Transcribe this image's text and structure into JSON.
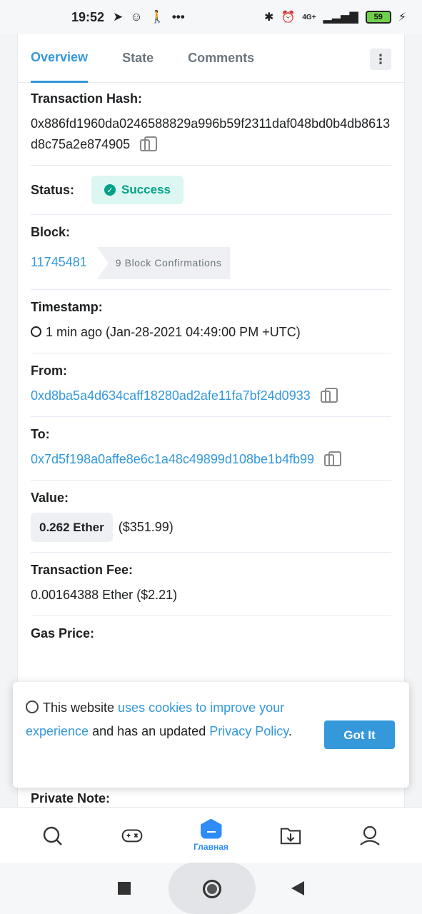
{
  "status_bar": {
    "time": "19:52",
    "left_icons": [
      "telegram-icon",
      "alien-icon",
      "walking-icon",
      "more-dots-icon"
    ],
    "network": "4G+",
    "battery": "59"
  },
  "tabs": [
    {
      "label": "Overview",
      "active": true
    },
    {
      "label": "State",
      "active": false
    },
    {
      "label": "Comments",
      "active": false
    }
  ],
  "tx": {
    "hash_label": "Transaction Hash:",
    "hash": "0x886fd1960da0246588829a996b59f2311daf048bd0b4db8613d8c75a2e874905",
    "status_label": "Status:",
    "status": "Success",
    "block_label": "Block:",
    "block": "11745481",
    "confirmations": "9 Block Confirmations",
    "timestamp_label": "Timestamp:",
    "timestamp": "1 min ago (Jan-28-2021 04:49:00 PM +UTC)",
    "from_label": "From:",
    "from": "0xd8ba5a4d634caff18280ad2afe11fa7bf24d0933",
    "to_label": "To:",
    "to": "0x7d5f198a0affe8e6c1a48c49899d108be1b4fb99",
    "value_label": "Value:",
    "value_ether": "0.262 Ether",
    "value_usd": "($351.99)",
    "fee_label": "Transaction Fee:",
    "fee": "0.00164388 Ether ($2.21)",
    "gas_label": "Gas Price:",
    "note_label": "Private Note:"
  },
  "cookie": {
    "text_before": "This website ",
    "link1": "uses cookies to improve your experience",
    "text_middle": " and has an updated ",
    "link2": "Privacy Policy",
    "text_after": ".",
    "button": "Got It"
  },
  "bottom_nav": {
    "home_label": "Главная"
  },
  "colors": {
    "accent": "#3498db",
    "success": "#00a186",
    "success_bg": "#dcf6f1",
    "nav_active": "#2f8bf5"
  }
}
